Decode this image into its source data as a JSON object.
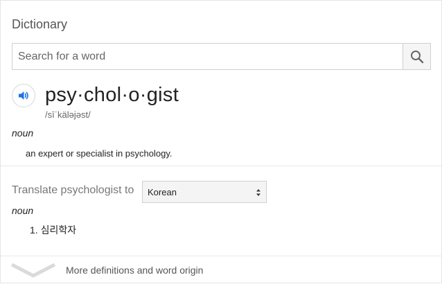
{
  "card": {
    "title": "Dictionary",
    "search": {
      "placeholder": "Search for a word",
      "value": "",
      "button_icon": "search-icon"
    },
    "entry": {
      "speaker_icon": "speaker-icon",
      "headword": "psy·chol·o·gist",
      "phonetic": "/sīˈkäləjəst/",
      "pos": "noun",
      "definition": "an expert or specialist in psychology."
    },
    "translate": {
      "label": "Translate psychologist to",
      "selected_language": "Korean",
      "pos": "noun",
      "items": [
        {
          "number": "1.",
          "text": "심리학자"
        }
      ]
    },
    "more": {
      "label": "More definitions and word origin",
      "icon": "chevron-down-icon"
    }
  },
  "colors": {
    "accent": "#1a73e8",
    "border": "#cfcfcf",
    "muted": "#666666"
  }
}
